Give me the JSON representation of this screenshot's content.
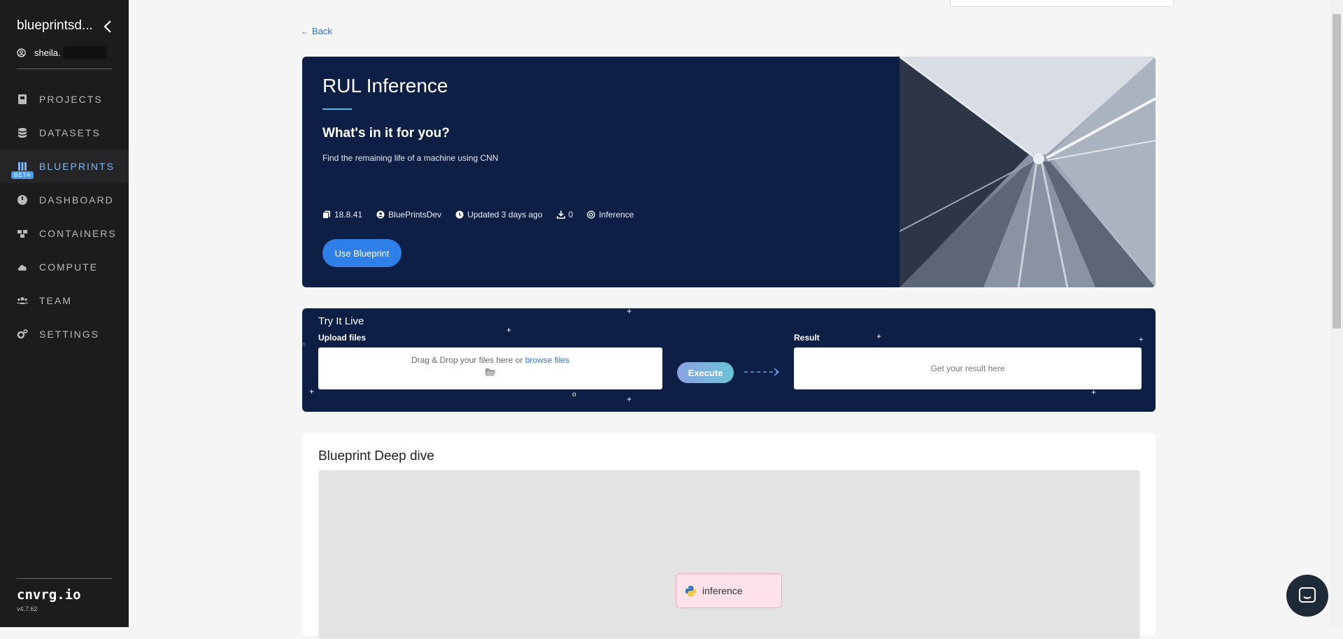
{
  "sidebar": {
    "org_name": "blueprintsd...",
    "user_name": "sheila.",
    "items": [
      {
        "label": "PROJECTS",
        "icon": "projects-icon"
      },
      {
        "label": "DATASETS",
        "icon": "database-icon"
      },
      {
        "label": "BLUEPRINTS",
        "icon": "blueprints-icon",
        "badge": "BETA",
        "active": true
      },
      {
        "label": "DASHBOARD",
        "icon": "dashboard-icon"
      },
      {
        "label": "CONTAINERS",
        "icon": "containers-icon"
      },
      {
        "label": "COMPUTE",
        "icon": "cloud-icon"
      },
      {
        "label": "TEAM",
        "icon": "team-icon"
      },
      {
        "label": "SETTINGS",
        "icon": "settings-icon"
      }
    ],
    "brand": "cnvrg.io",
    "version": "v4.7.62"
  },
  "back_label": "Back",
  "hero": {
    "title": "RUL Inference",
    "subtitle": "What's in it for you?",
    "description": "Find the remaining life of a machine using CNN",
    "meta": {
      "version": "18.8.41",
      "author": "BluePrintsDev",
      "updated": "Updated 3 days ago",
      "downloads": "0",
      "type": "Inference"
    },
    "button": "Use Blueprint"
  },
  "try_live": {
    "title": "Try It Live",
    "upload_label": "Upload files",
    "drop_text": "Drag & Drop your files here or",
    "browse_text": "browse files",
    "execute": "Execute",
    "result_label": "Result",
    "result_placeholder": "Get your result here"
  },
  "deep_dive": {
    "title": "Blueprint Deep dive",
    "node_label": "inference"
  },
  "colors": {
    "sidebar_bg": "#1c1c1e",
    "hero_bg": "#0d1f45",
    "accent": "#2f7fe8",
    "active_nav": "#7fb6f2"
  }
}
